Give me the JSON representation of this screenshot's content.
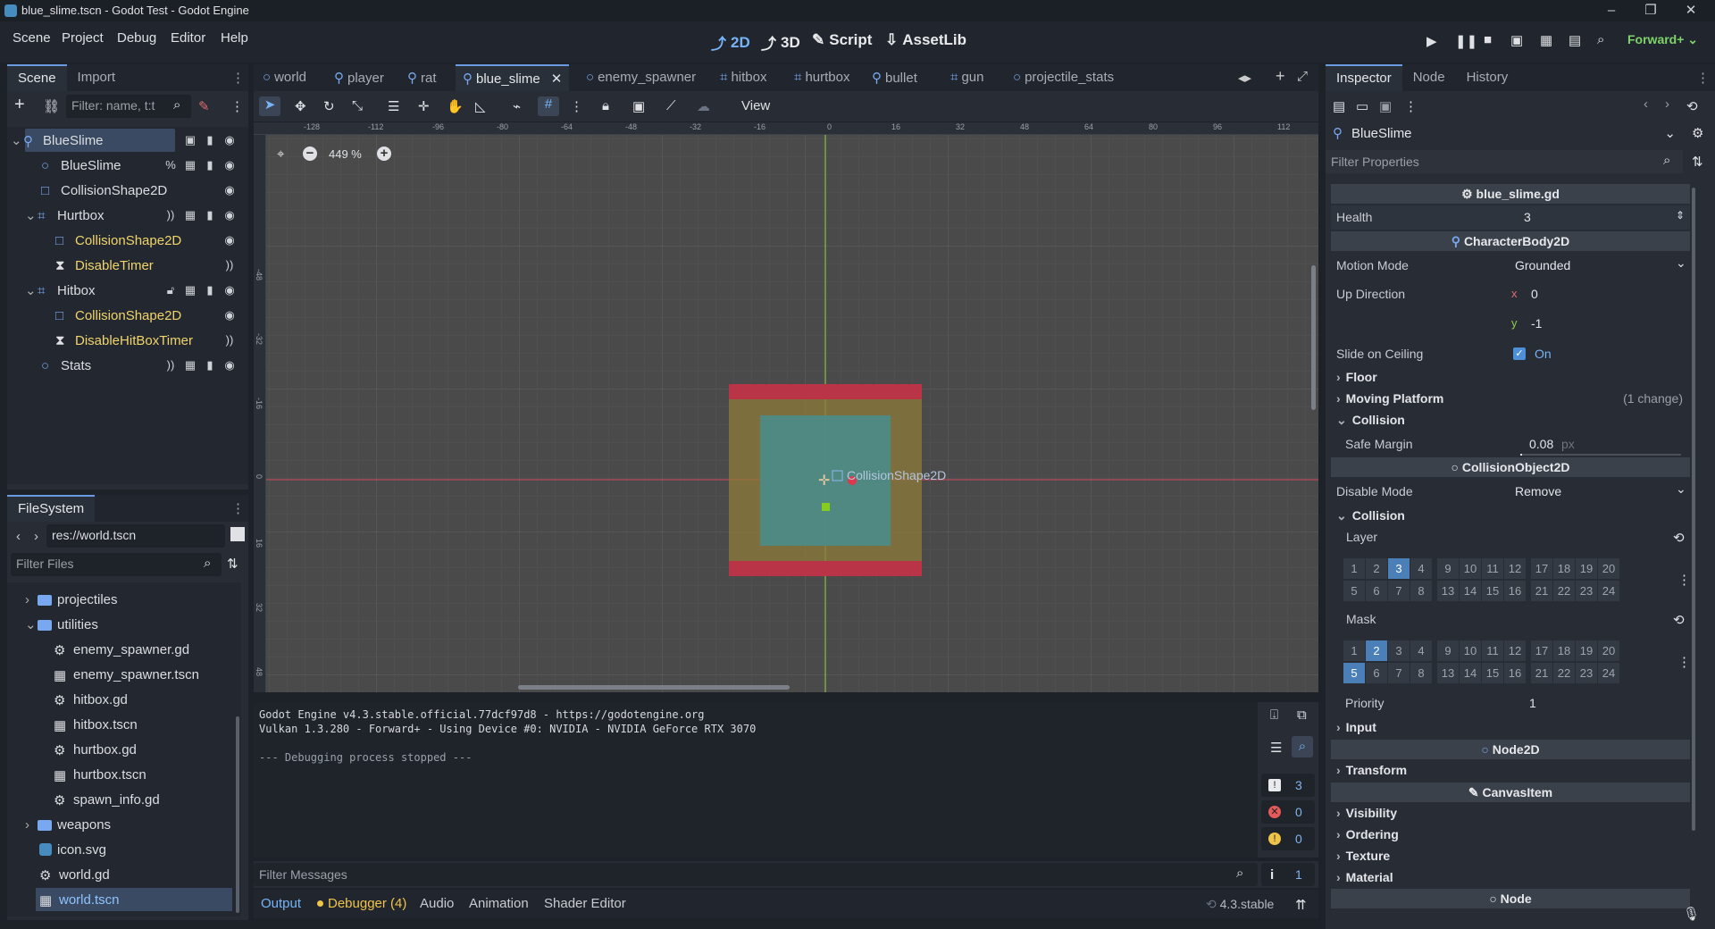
{
  "window": {
    "title": "blue_slime.tscn - Godot Test - Godot Engine"
  },
  "menu": {
    "items": [
      "Scene",
      "Project",
      "Debug",
      "Editor",
      "Help"
    ],
    "modes": [
      "2D",
      "3D",
      "Script",
      "AssetLib"
    ],
    "renderer": "Forward+"
  },
  "scene_dock": {
    "tabs": [
      "Scene",
      "Import"
    ],
    "filter_placeholder": "Filter: name, t:t",
    "nodes": [
      {
        "name": "BlueSlime",
        "icon": "character-icon",
        "selected": true
      },
      {
        "name": "BlueSlime",
        "icon": "node2d-icon"
      },
      {
        "name": "CollisionShape2D",
        "icon": "collision-icon"
      },
      {
        "name": "Hurtbox",
        "icon": "area-icon"
      },
      {
        "name": "CollisionShape2D",
        "icon": "collision-icon"
      },
      {
        "name": "DisableTimer",
        "icon": "timer-icon"
      },
      {
        "name": "Hitbox",
        "icon": "area-icon"
      },
      {
        "name": "CollisionShape2D",
        "icon": "collision-icon"
      },
      {
        "name": "DisableHitBoxTimer",
        "icon": "timer-icon"
      },
      {
        "name": "Stats",
        "icon": "node-icon"
      }
    ]
  },
  "filesystem": {
    "tab": "FileSystem",
    "path": "res://world.tscn",
    "filter_placeholder": "Filter Files",
    "items": [
      "projectiles",
      "utilities",
      "enemy_spawner.gd",
      "enemy_spawner.tscn",
      "hitbox.gd",
      "hitbox.tscn",
      "hurtbox.gd",
      "hurtbox.tscn",
      "spawn_info.gd",
      "weapons",
      "icon.svg",
      "world.gd",
      "world.tscn"
    ]
  },
  "scene_tabs": [
    "world",
    "player",
    "rat",
    "blue_slime",
    "enemy_spawner",
    "hitbox",
    "hurtbox",
    "bullet",
    "gun",
    "projectile_stats"
  ],
  "toolbar": {
    "view_label": "View"
  },
  "viewport": {
    "zoom": "449 %",
    "shape_label": "CollisionShape2D",
    "ruler_top": [
      "-128",
      "-112",
      "-96",
      "-80",
      "-64",
      "-48",
      "-32",
      "-16",
      "0",
      "16",
      "32",
      "48",
      "64",
      "80",
      "96",
      "112"
    ],
    "ruler_left": [
      "-48",
      "-32",
      "-16",
      "0",
      "16",
      "32",
      "48"
    ]
  },
  "console": {
    "lines": [
      "Godot Engine v4.3.stable.official.77dcf97d8 - https://godotengine.org",
      "Vulkan 1.3.280 - Forward+ - Using Device #0: NVIDIA - NVIDIA GeForce RTX 3070",
      "",
      "--- Debugging process stopped ---"
    ],
    "filter_placeholder": "Filter Messages",
    "counts": [
      "3",
      "0",
      "0",
      "1"
    ]
  },
  "bottom_tabs": [
    "Output",
    "Debugger (4)",
    "Audio",
    "Animation",
    "Shader Editor"
  ],
  "version": "4.3.stable",
  "inspector": {
    "tabs": [
      "Inspector",
      "Node",
      "History"
    ],
    "node_name": "BlueSlime",
    "filter_placeholder": "Filter Properties",
    "script_header": "blue_slime.gd",
    "health_label": "Health",
    "health_value": "3",
    "class_character": "CharacterBody2D",
    "motion_mode_label": "Motion Mode",
    "motion_mode_value": "Grounded",
    "up_direction_label": "Up Direction",
    "up_x": "0",
    "up_y": "-1",
    "slide_label": "Slide on Ceiling",
    "slide_value": "On",
    "floor": "Floor",
    "moving_platform": "Moving Platform",
    "moving_platform_note": "(1 change)",
    "collision": "Collision",
    "safe_margin_label": "Safe Margin",
    "safe_margin_value": "0.08",
    "safe_margin_unit": "px",
    "class_collision_object": "CollisionObject2D",
    "disable_mode_label": "Disable Mode",
    "disable_mode_value": "Remove",
    "collision2": "Collision",
    "layer_label": "Layer",
    "mask_label": "Mask",
    "layer_on": [
      "3"
    ],
    "mask_on": [
      "2",
      "5"
    ],
    "priority_label": "Priority",
    "priority_value": "1",
    "input": "Input",
    "class_node2d": "Node2D",
    "transform": "Transform",
    "class_canvas": "CanvasItem",
    "visibility": "Visibility",
    "ordering": "Ordering",
    "texture": "Texture",
    "material": "Material",
    "class_node": "Node"
  }
}
